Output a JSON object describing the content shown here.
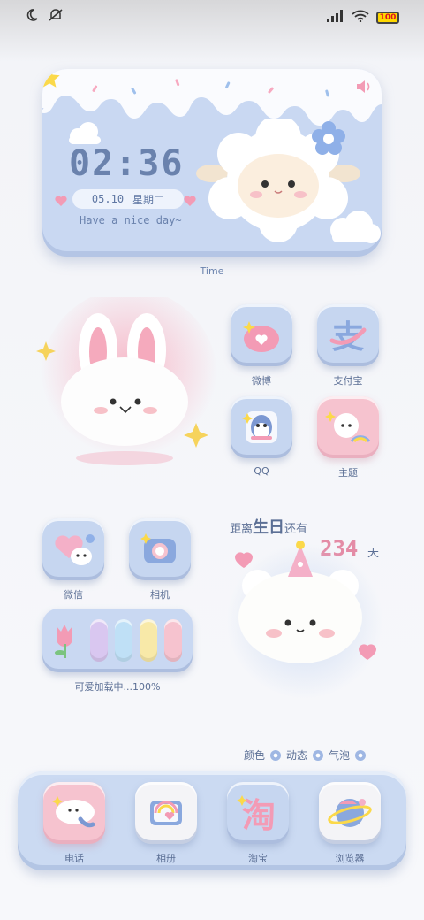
{
  "status_bar": {
    "icons_left": [
      "moon-icon",
      "mute-icon"
    ],
    "icons_right": [
      "signal-icon",
      "wifi-icon",
      "battery-icon"
    ],
    "battery": "100"
  },
  "clock_widget": {
    "time": "02:36",
    "date": "05.10",
    "weekday": "星期二",
    "greeting": "Have a nice day~",
    "caption": "Time"
  },
  "apps_grid_1": [
    {
      "label": "微博"
    },
    {
      "label": "支付宝"
    },
    {
      "label": "QQ"
    },
    {
      "label": "主题"
    }
  ],
  "apps_grid_2": [
    {
      "label": "微信"
    },
    {
      "label": "相机"
    }
  ],
  "loading_widget": {
    "text": "可爱加载中...100%",
    "pill_colors": [
      "#f3c6d4",
      "#d8c8f0",
      "#bfe0f6",
      "#f8e9a8",
      "#f6c3cf"
    ]
  },
  "countdown": {
    "prefix": "距离",
    "highlight": "生日",
    "suffix": "还有",
    "days": "234",
    "unit": "天"
  },
  "theme_links": [
    "颜色",
    "动态",
    "气泡"
  ],
  "dock": [
    {
      "label": "电话"
    },
    {
      "label": "相册"
    },
    {
      "label": "淘宝"
    },
    {
      "label": "浏览器"
    }
  ],
  "colors": {
    "accent_blue": "#c9d8f2",
    "accent_pink": "#f6c3cf",
    "text": "#5b6f95",
    "days": "#e48ca6"
  }
}
